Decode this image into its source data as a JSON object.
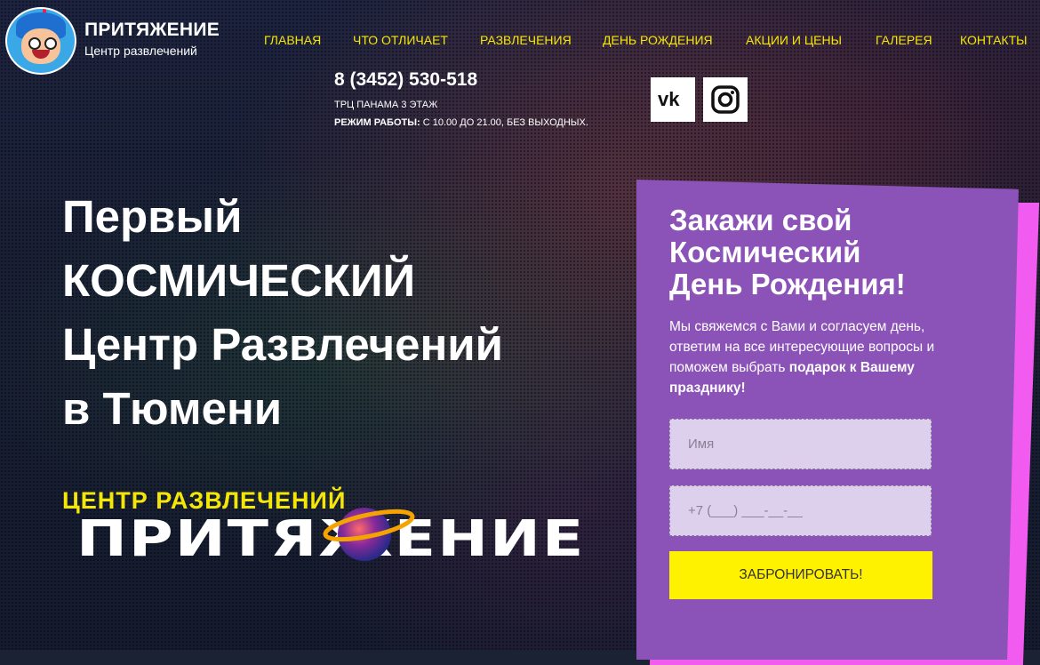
{
  "brand": {
    "title": "ПРИТЯЖЕНИЕ",
    "subtitle": "Центр развлечений"
  },
  "nav": [
    {
      "label": "ГЛАВНАЯ"
    },
    {
      "label": "ЧТО ОТЛИЧАЕТ"
    },
    {
      "label": "РАЗВЛЕЧЕНИЯ"
    },
    {
      "label": "ДЕНЬ РОЖДЕНИЯ"
    },
    {
      "label": "АКЦИИ И ЦЕНЫ"
    },
    {
      "label": "ГАЛЕРЕЯ"
    },
    {
      "label": "КОНТАКТЫ"
    }
  ],
  "contact": {
    "phone": "8 (3452) 530-518",
    "address": "ТРЦ ПАНАМА 3 ЭТАЖ",
    "hours_label": "РЕЖИМ РАБОТЫ:",
    "hours_value": " С 10.00 ДО 21.00, БЕЗ ВЫХОДНЫХ."
  },
  "social": [
    {
      "name": "vk-icon",
      "text": "vk"
    },
    {
      "name": "instagram-icon"
    }
  ],
  "hero": {
    "lines": [
      "Первый",
      "КОСМИЧЕСКИЙ",
      "Центр Развлечений",
      "в Тюмени"
    ]
  },
  "big_logo": {
    "sub": "ЦЕНТР РАЗВЛЕЧЕНИЙ",
    "word": "ПРИТЯЖЕНИЕ"
  },
  "form": {
    "title_lines": [
      "Закажи свой",
      "Космический",
      "День Рождения!"
    ],
    "text": "Мы свяжемся с Вами и согласуем день, ответим на все интересующие вопросы и поможем выбрать ",
    "text_bold": "подарок к Вашему празднику!",
    "name_placeholder": "Имя",
    "phone_placeholder": "+7 (___) ___-__-__",
    "submit_label": "ЗАБРОНИРОВАТЬ!"
  },
  "colors": {
    "accent_yellow": "#f5e60a",
    "card_purple": "#8b52b8",
    "card_pink": "#f15bf0",
    "button_yellow": "#fff200"
  }
}
